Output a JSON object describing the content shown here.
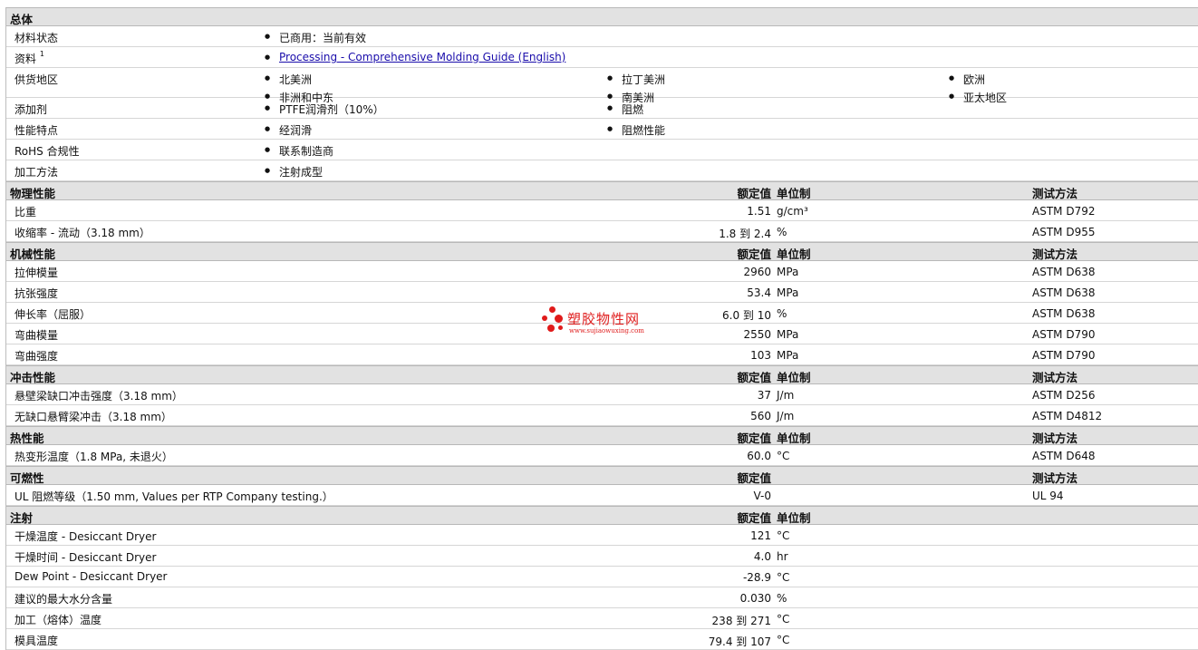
{
  "general": {
    "title": "总体",
    "material_status": {
      "label": "材料状态",
      "value": "已商用：当前有效"
    },
    "literature": {
      "label": "资料",
      "sup": "1",
      "link": "Processing - Comprehensive Molding Guide (English)"
    },
    "availability": {
      "label": "供货地区",
      "items": [
        "北美洲",
        "拉丁美洲",
        "欧洲",
        "非洲和中东",
        "南美洲",
        "亚太地区"
      ]
    },
    "additive": {
      "label": "添加剂",
      "items": [
        "PTFE润滑剂（10%）",
        "阻燃"
      ]
    },
    "features": {
      "label": "性能特点",
      "items": [
        "经润滑",
        "阻燃性能"
      ]
    },
    "rohs": {
      "label": "RoHS 合规性",
      "value": "联系制造商"
    },
    "processing_method": {
      "label": "加工方法",
      "value": "注射成型"
    }
  },
  "headers": {
    "value": "额定值",
    "unit": "单位制",
    "method": "测试方法"
  },
  "physical": {
    "title": "物理性能",
    "rows": [
      {
        "label": "比重",
        "value": "1.51",
        "unit": "g/cm³",
        "method": "ASTM D792"
      },
      {
        "label": "收缩率 - 流动（3.18 mm）",
        "value": "1.8 到  2.4",
        "unit": "%",
        "method": "ASTM D955"
      }
    ]
  },
  "mechanical": {
    "title": "机械性能",
    "rows": [
      {
        "label": "拉伸模量",
        "value": "2960",
        "unit": "MPa",
        "method": "ASTM D638"
      },
      {
        "label": "抗张强度",
        "value": "53.4",
        "unit": "MPa",
        "method": "ASTM D638"
      },
      {
        "label": "伸长率（屈服）",
        "value": "6.0 到  10",
        "unit": "%",
        "method": "ASTM D638"
      },
      {
        "label": "弯曲模量",
        "value": "2550",
        "unit": "MPa",
        "method": "ASTM D790"
      },
      {
        "label": "弯曲强度",
        "value": "103",
        "unit": "MPa",
        "method": "ASTM D790"
      }
    ]
  },
  "impact": {
    "title": "冲击性能",
    "rows": [
      {
        "label": "悬壁梁缺口冲击强度（3.18 mm）",
        "value": "37",
        "unit": "J/m",
        "method": "ASTM D256"
      },
      {
        "label": "无缺口悬臂梁冲击（3.18 mm）",
        "value": "560",
        "unit": "J/m",
        "method": "ASTM D4812"
      }
    ]
  },
  "thermal": {
    "title": "热性能",
    "rows": [
      {
        "label": "热变形温度（1.8 MPa, 未退火）",
        "value": "60.0",
        "unit": "°C",
        "method": "ASTM D648"
      }
    ]
  },
  "flammability": {
    "title": "可燃性",
    "rows": [
      {
        "label": "UL 阻燃等级（1.50 mm, Values per RTP Company testing.）",
        "value": "V-0",
        "method": "UL 94"
      }
    ]
  },
  "injection": {
    "title": "注射",
    "rows": [
      {
        "label": "干燥温度 - Desiccant Dryer",
        "value": "121",
        "unit": "°C"
      },
      {
        "label": "干燥时间 - Desiccant Dryer",
        "value": "4.0",
        "unit": "hr"
      },
      {
        "label": "Dew Point - Desiccant Dryer",
        "value": "-28.9",
        "unit": "°C"
      },
      {
        "label": "建议的最大水分含量",
        "value": "0.030",
        "unit": "%"
      },
      {
        "label": "加工（熔体）温度",
        "value": "238 到  271",
        "unit": "°C"
      },
      {
        "label": "模具温度",
        "value": "79.4 到  107",
        "unit": "°C"
      }
    ]
  },
  "watermark": {
    "title": "塑胶物性网",
    "url": "www.sujiaowuxing.com"
  },
  "colors": {
    "section_bg": "#e2e2e2",
    "link": "#1a0dab",
    "watermark": "#e02020"
  }
}
